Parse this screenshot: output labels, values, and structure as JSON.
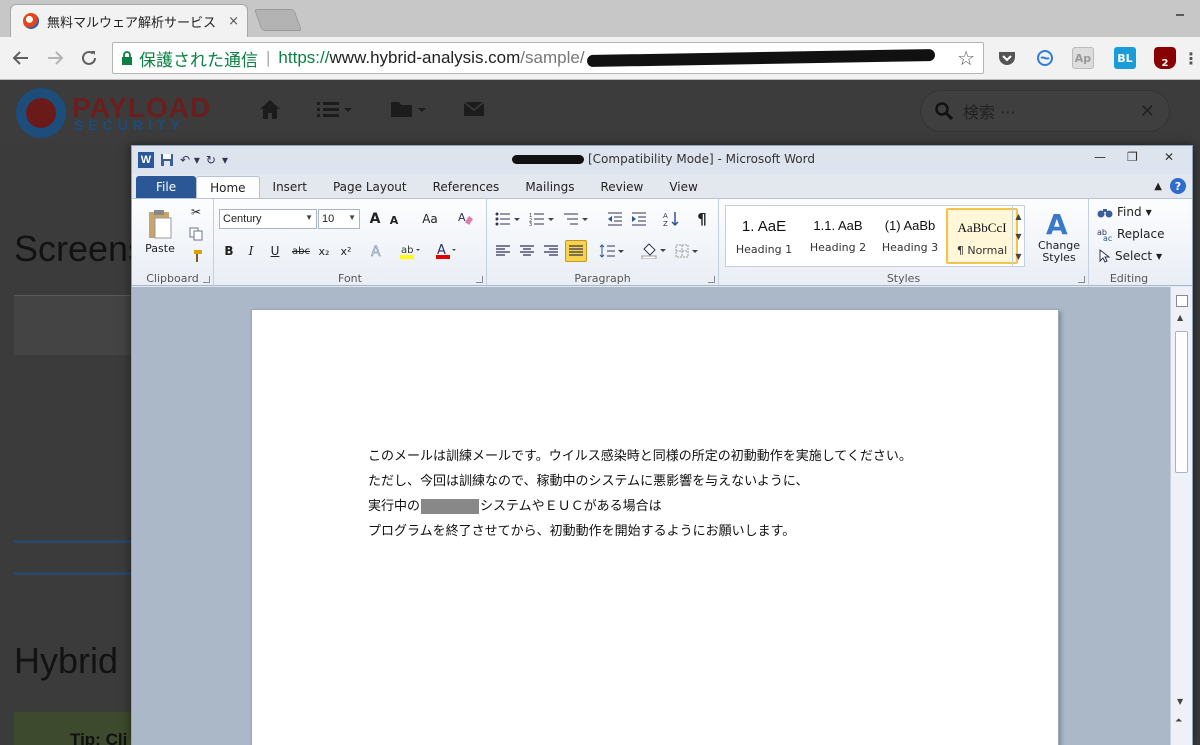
{
  "browser": {
    "tab_title": "無料マルウェア解析サービス",
    "tab_close": "×",
    "secure_label": "保護された通信",
    "url_protocol": "https://",
    "url_host": "www.hybrid-analysis.com",
    "url_path": "/sample/",
    "extensions": [
      {
        "name": "pocket-icon",
        "label": "",
        "color": "#555"
      },
      {
        "name": "sync-icon",
        "label": "",
        "color": "#2d7de0"
      },
      {
        "name": "ap-icon",
        "label": "Ap",
        "color": "#999"
      },
      {
        "name": "bl-icon",
        "label": "BL",
        "color": "#1a9cd8"
      },
      {
        "name": "ublock-icon",
        "label": "2",
        "color": "#800"
      }
    ]
  },
  "site": {
    "logo_top": "PAYLOAD",
    "logo_bottom": "SECURITY",
    "search_placeholder": "検索 ···",
    "heading1": "Screens",
    "heading2": "Hybrid",
    "tip": "Tip: Cli"
  },
  "word": {
    "title": "[Compatibility Mode] - Microsoft Word",
    "tabs": [
      "File",
      "Home",
      "Insert",
      "Page Layout",
      "References",
      "Mailings",
      "Review",
      "View"
    ],
    "clipboard": {
      "label": "Clipboard",
      "paste": "Paste"
    },
    "font": {
      "label": "Font",
      "name": "Century",
      "size": "10",
      "bold": "B",
      "italic": "I",
      "underline": "U",
      "strike": "abc",
      "sub": "x₂",
      "sup": "x²",
      "grow": "A",
      "shrink": "A",
      "case": "Aa"
    },
    "paragraph": {
      "label": "Paragraph",
      "pilcrow": "¶"
    },
    "styles": {
      "label": "Styles",
      "items": [
        {
          "sample": "1. AaE",
          "name": "Heading 1"
        },
        {
          "sample": "1.1. AaB",
          "name": "Heading 2"
        },
        {
          "sample": "(1) AaBb",
          "name": "Heading 3"
        },
        {
          "sample": "AaBbCcI",
          "name": "¶ Normal"
        }
      ],
      "change_styles": "Change Styles"
    },
    "editing": {
      "label": "Editing",
      "find": "Find",
      "replace": "Replace",
      "select": "Select"
    },
    "document": {
      "line1": "このメールは訓練メールです。ウイルス感染時と同様の所定の初動動作を実施してください。",
      "line2": "ただし、今回は訓練なので、稼動中のシステムに悪影響を与えないように、",
      "line3a": "実行中の",
      "line3b": "システムやＥＵＣがある場合は",
      "line4": "プログラムを終了させてから、初動動作を開始するようにお願いします。"
    }
  }
}
